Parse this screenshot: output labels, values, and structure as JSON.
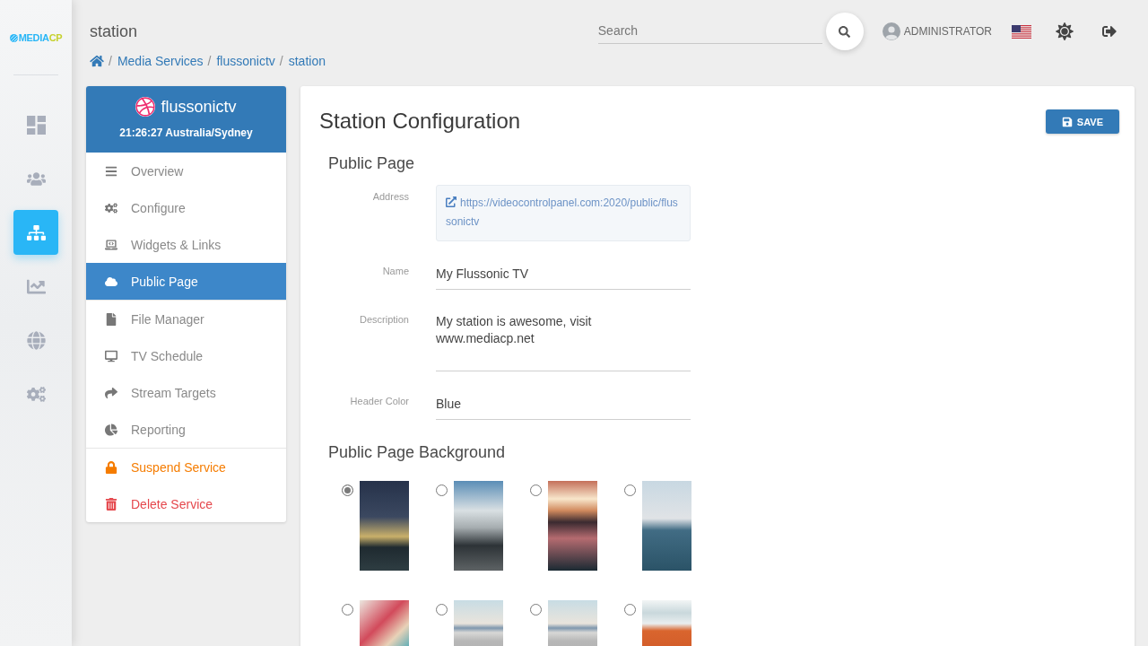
{
  "sidebar": {
    "logo": [
      "MEDIA",
      "CP"
    ],
    "items": [
      {
        "selected": false
      },
      {
        "selected": false
      },
      {
        "selected": true
      },
      {
        "selected": false
      },
      {
        "selected": false
      },
      {
        "selected": false
      }
    ]
  },
  "header": {
    "title": "station",
    "search": {
      "placeholder": "Search"
    },
    "user": "ADMINISTRATOR"
  },
  "breadcrumb": [
    {
      "separator": "/",
      "label": "Media Services"
    },
    {
      "separator": "/",
      "label": "flussonictv"
    },
    {
      "separator": "/",
      "label": "station"
    }
  ],
  "service": {
    "name": "flussonictv",
    "time": "21:26:27 Australia/Sydney",
    "menu": [
      {
        "items": [
          {
            "label": "Overview",
            "kind": "nav",
            "selected": false
          },
          {
            "label": "Configure",
            "kind": "nav",
            "selected": false
          },
          {
            "label": "Widgets & Links",
            "kind": "nav",
            "selected": false
          },
          {
            "label": "Public Page",
            "kind": "nav",
            "selected": true
          }
        ]
      },
      {
        "items": [
          {
            "label": "File Manager",
            "kind": "nav",
            "selected": false
          },
          {
            "label": "TV Schedule",
            "kind": "nav",
            "selected": false
          },
          {
            "label": "Stream Targets",
            "kind": "nav",
            "selected": false
          },
          {
            "label": "Reporting",
            "kind": "nav",
            "selected": false
          }
        ]
      },
      {
        "items": [
          {
            "label": "Suspend Service",
            "kind": "warning",
            "selected": false
          },
          {
            "label": "Delete Service",
            "kind": "danger",
            "selected": false
          }
        ]
      }
    ]
  },
  "content": {
    "title": "Station Configuration",
    "save_button": "SAVE",
    "public_page": {
      "title": "Public Page",
      "fields": [
        {
          "label": "Address",
          "kind": "link",
          "value": "https://videocontrolpanel.com:2020/public/flussonictv"
        },
        {
          "label": "Name",
          "kind": "text",
          "value": "My Flussonic TV"
        },
        {
          "label": "Description",
          "kind": "textarea",
          "value": "My station is awesome, visit www.mediacp.net"
        },
        {
          "label": "Header Color",
          "kind": "text",
          "value": "Blue"
        }
      ]
    },
    "background": {
      "title": "Public Page Background",
      "options": [
        {
          "selected": true
        },
        {
          "selected": false
        },
        {
          "selected": false
        },
        {
          "selected": false
        },
        {
          "selected": false
        },
        {
          "selected": false
        },
        {
          "selected": false
        },
        {
          "selected": false
        }
      ]
    }
  }
}
